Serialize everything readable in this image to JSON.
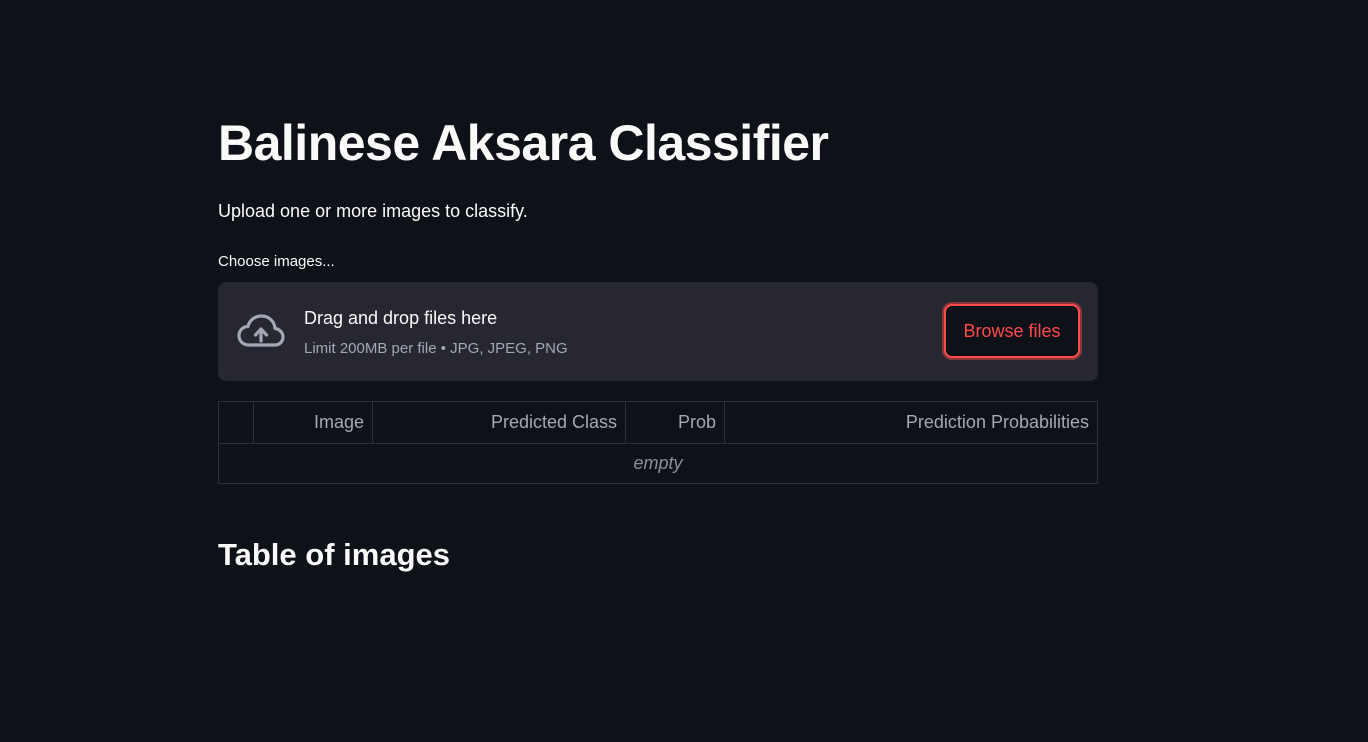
{
  "page": {
    "title": "Balinese Aksara Classifier",
    "subtitle": "Upload one or more images to classify."
  },
  "uploader": {
    "label": "Choose images...",
    "dropzone_title": "Drag and drop files here",
    "limits": "Limit 200MB per file • JPG, JPEG, PNG",
    "browse_label": "Browse files",
    "icon": "cloud-upload-icon"
  },
  "table": {
    "columns": [
      "",
      "Image",
      "Predicted Class",
      "Prob",
      "Prediction Probabilities"
    ],
    "empty_text": "empty"
  },
  "section": {
    "title": "Table of images"
  },
  "colors": {
    "background": "#0e1117",
    "panel": "#262730",
    "accent": "#ff4b4b",
    "text": "#fafafa",
    "muted_text": "#a3a8b4"
  }
}
